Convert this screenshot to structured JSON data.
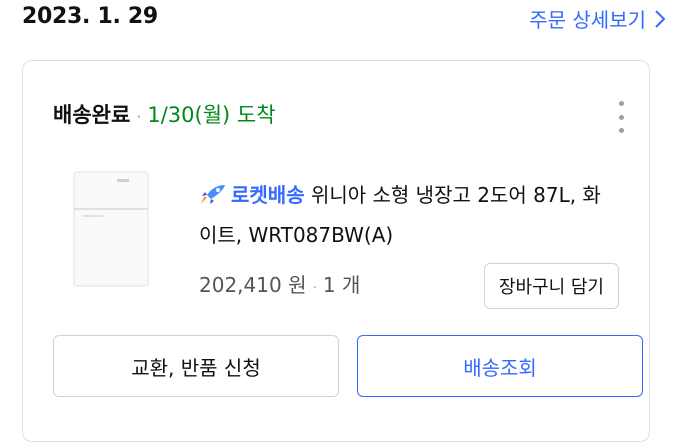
{
  "header": {
    "order_date": "2023. 1. 29",
    "detail_link_label": "주문 상세보기"
  },
  "order": {
    "status": "배송완료",
    "separator": "·",
    "arrival": "1/30(월) 도착",
    "product": {
      "badge": "로켓배송",
      "name_line1": "위니아 소형 냉장고 2도어 87L, 화",
      "name_line2": "이트, WRT087BW(A)",
      "price": "202,410 원",
      "quantity": "1 개"
    },
    "buttons": {
      "cart": "장바구니 담기",
      "return_exchange": "교환, 반품 신청",
      "track": "배송조회"
    }
  },
  "colors": {
    "accent_blue": "#346aff",
    "arrival_green": "#00891a",
    "border_gray": "#dcdfe4"
  },
  "icons": {
    "more": "more-vertical-icon",
    "chevron": "chevron-right-icon",
    "rocket": "rocket-icon"
  }
}
